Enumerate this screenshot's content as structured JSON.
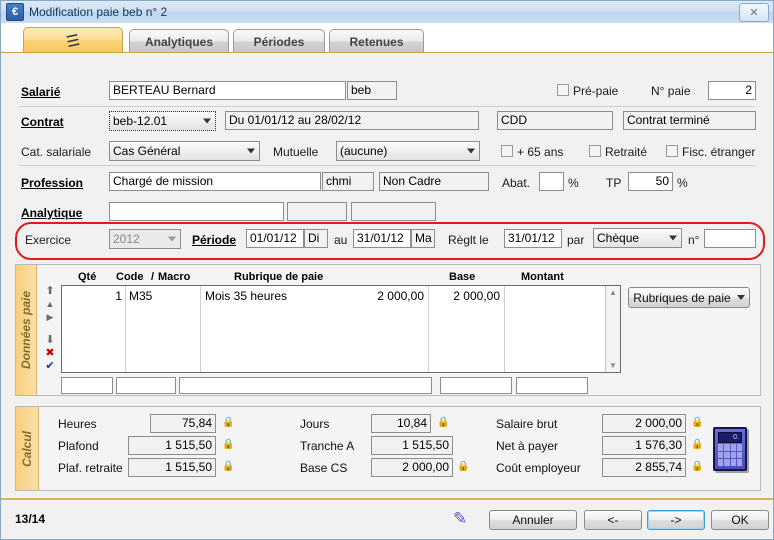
{
  "window": {
    "title": "Modification paie beb n° 2",
    "icon": "euro-icon",
    "close_label": "✕"
  },
  "tabs": [
    {
      "label": "",
      "icon": "payslip-icon",
      "active": true
    },
    {
      "label": "Analytiques",
      "active": false
    },
    {
      "label": "Périodes",
      "active": false
    },
    {
      "label": "Retenues",
      "active": false
    }
  ],
  "form": {
    "salarie_label": "Salarié",
    "salarie_value": "BERTEAU Bernard",
    "salarie_code": "beb",
    "prepaie_label": "Pré-paie",
    "prepaie_checked": false,
    "nopaie_label": "N° paie",
    "nopaie_value": "2",
    "contrat_label": "Contrat",
    "contrat_combo": "beb-12.01",
    "contrat_periode": "Du 01/01/12 au 28/02/12",
    "contrat_type": "CDD",
    "contrat_statut": "Contrat terminé",
    "cat_label": "Cat. salariale",
    "cat_value": "Cas Général",
    "mutuelle_label": "Mutuelle",
    "mutuelle_value": "(aucune)",
    "plus65_label": "+ 65 ans",
    "plus65_checked": false,
    "retraite_label": "Retraité",
    "retraite_checked": false,
    "fisc_label": "Fisc. étranger",
    "fisc_checked": false,
    "profession_label": "Profession",
    "profession_value": "Chargé de mission",
    "profession_code": "chmi",
    "profession_cadre": "Non Cadre",
    "abat_label": "Abat.",
    "abat_value": "",
    "abat_unit": "%",
    "tp_label": "TP",
    "tp_value": "50",
    "tp_unit": "%",
    "analytique_label": "Analytique",
    "analytique_v1": "",
    "analytique_v2": "",
    "analytique_v3": "",
    "exercice_label": "Exercice",
    "exercice_value": "2012",
    "periode_label": "Période",
    "periode_debut": "01/01/12",
    "periode_debut_jour": "Di",
    "periode_au": "au",
    "periode_fin": "31/01/12",
    "periode_fin_jour": "Ma",
    "reglt_label": "Règlt le",
    "reglt_date": "31/01/12",
    "par_label": "par",
    "reglt_mode": "Chèque",
    "numero_label": "n°",
    "numero_value": ""
  },
  "donnees_paie": {
    "panel_label": "Données paie",
    "columns": [
      "Qté",
      "Code / Macro",
      "Rubrique de paie",
      "Base",
      "Montant"
    ],
    "col_qte": "Qté",
    "col_code": "Code",
    "col_slash": "/",
    "col_macro": "Macro",
    "col_rubrique": "Rubrique de paie",
    "col_base": "Base",
    "col_montant": "Montant",
    "rows": [
      {
        "qte": "1",
        "code": "M35",
        "rubrique": "Mois 35 heures",
        "base": "2 000,00",
        "montant": "2 000,00"
      }
    ],
    "edit_qte": "",
    "edit_code": "",
    "edit_rubrique": "",
    "edit_base": "",
    "edit_montant": "",
    "rubriques_button": "Rubriques de paie",
    "tools": [
      "⬆",
      "⬆",
      "⬇",
      "⬇",
      "✕",
      "✔"
    ]
  },
  "calcul": {
    "panel_label": "Calcul",
    "fields": [
      {
        "label": "Heures",
        "value": "75,84",
        "locked": true
      },
      {
        "label": "Plafond",
        "value": "1 515,50",
        "locked": true
      },
      {
        "label": "Plaf. retraite",
        "value": "1 515,50",
        "locked": true
      },
      {
        "label": "Jours",
        "value": "10,84",
        "locked": true
      },
      {
        "label": "Tranche A",
        "value": "1 515,50",
        "locked": false
      },
      {
        "label": "Base CS",
        "value": "2 000,00",
        "locked": true
      },
      {
        "label": "Salaire brut",
        "value": "2 000,00",
        "locked": true
      },
      {
        "label": "Net à payer",
        "value": "1 576,30",
        "locked": true
      },
      {
        "label": "Coût employeur",
        "value": "2 855,74",
        "locked": true
      }
    ],
    "calculator_icon": "calculator-icon",
    "calculator_display": "0."
  },
  "footer": {
    "pager": "13/14",
    "pencil_icon": "pencil-icon",
    "cancel_label": "Annuler",
    "prev_label": "<-",
    "next_label": "->",
    "ok_label": "OK"
  },
  "colors": {
    "accent_orange": "#f7cf7d",
    "highlight_red": "#e01b1b",
    "title_blue": "#cfe0f2",
    "focus_blue": "#3c9ddd"
  }
}
